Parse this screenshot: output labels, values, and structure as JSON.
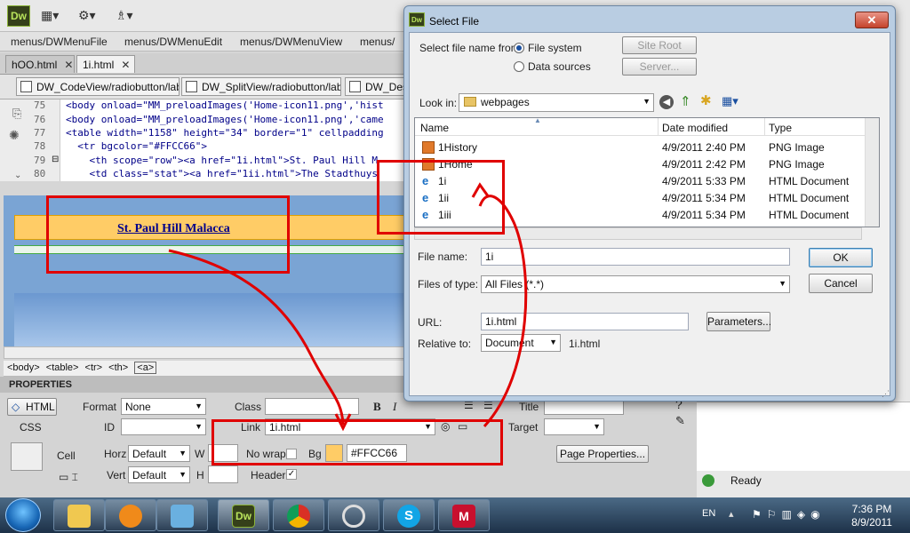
{
  "dreamweaver": {
    "logo": "Dw",
    "menus": [
      "menus/DWMenuFile",
      "menus/DWMenuEdit",
      "menus/DWMenuView",
      "menus/"
    ],
    "doc_tabs": [
      {
        "label": "hOO.html"
      },
      {
        "label": "1i.html"
      }
    ],
    "related": [
      "DW_CodeView/radiobutton/label",
      "DW_SplitView/radiobutton/label",
      "DW_Des"
    ],
    "code_lines": [
      {
        "num": "75",
        "text": "<body onload=\"MM_preloadImages('Home-icon11.png','hist"
      },
      {
        "num": "76",
        "text": "<body onload=\"MM_preloadImages('Home-icon11.png','came"
      },
      {
        "num": "77",
        "text": "<table width=\"1158\" height=\"34\" border=\"1\" cellpadding"
      },
      {
        "num": "78",
        "text": "  <tr bgcolor=\"#FFCC66\">"
      },
      {
        "num": "79",
        "text": "    <th scope=\"row\"><a href=\"1i.html\">St. Paul Hill M"
      },
      {
        "num": "80",
        "text": "    <td class=\"stat\"><a href=\"1ii.html\">The Stadthuys"
      }
    ],
    "design_link": "St. Paul Hill Malacca",
    "tag_selector": [
      "<body>",
      "<table>",
      "<tr>",
      "<th>",
      "<a>"
    ],
    "properties": {
      "header": "PROPERTIES",
      "html_btn": "HTML",
      "css_btn": "CSS",
      "format_label": "Format",
      "format_value": "None",
      "id_label": "ID",
      "class_label": "Class",
      "link_label": "Link",
      "link_value": "1i.html",
      "target_label": "Target",
      "title_label": "Title",
      "cell_label": "Cell",
      "horz_label": "Horz",
      "horz_value": "Default",
      "vert_label": "Vert",
      "vert_value": "Default",
      "w_label": "W",
      "h_label": "H",
      "nowrap_label": "No wrap",
      "bg_label": "Bg",
      "bg_value": "#FFCC66",
      "header_label": "Header",
      "page_props": "Page Properties..."
    },
    "status": "Ready"
  },
  "dialog": {
    "logo": "Dw",
    "title": "Select File",
    "select_from_label": "Select file name from:",
    "opt_filesystem": "File system",
    "opt_datasources": "Data sources",
    "site_root": "Site Root",
    "server": "Server...",
    "look_in_label": "Look in:",
    "look_in_value": "webpages",
    "columns": [
      "Name",
      "Date modified",
      "Type"
    ],
    "files": [
      {
        "name": "1History",
        "date": "4/9/2011 2:40 PM",
        "type": "PNG Image",
        "kind": "png"
      },
      {
        "name": "1Home",
        "date": "4/9/2011 2:42 PM",
        "type": "PNG Image",
        "kind": "png"
      },
      {
        "name": "1i",
        "date": "4/9/2011 5:33 PM",
        "type": "HTML Document",
        "kind": "html"
      },
      {
        "name": "1ii",
        "date": "4/9/2011 5:34 PM",
        "type": "HTML Document",
        "kind": "html"
      },
      {
        "name": "1iii",
        "date": "4/9/2011 5:34 PM",
        "type": "HTML Document",
        "kind": "html"
      }
    ],
    "filename_label": "File name:",
    "filename_value": "1i",
    "filetype_label": "Files of type:",
    "filetype_value": "All Files (*.*)",
    "ok": "OK",
    "cancel": "Cancel",
    "url_label": "URL:",
    "url_value": "1i.html",
    "params": "Parameters...",
    "relative_label": "Relative to:",
    "relative_value": "Document",
    "relative_file": "1i.html"
  },
  "taskbar": {
    "lang": "EN",
    "time": "7:36 PM",
    "date": "8/9/2011",
    "apps": [
      "explorer",
      "media-player",
      "paint",
      "dreamweaver",
      "chrome",
      "app-5",
      "skype",
      "mcafee"
    ]
  },
  "colors": {
    "row_bg": "#FFCC66",
    "annotation": "#e00000",
    "accent": "#1a4fa0"
  }
}
